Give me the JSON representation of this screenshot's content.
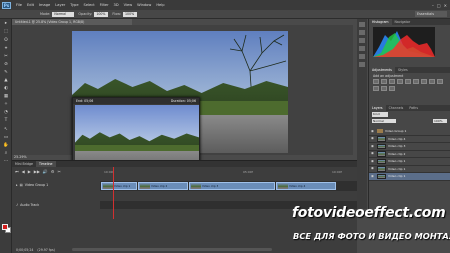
{
  "app": {
    "logo": "Ps"
  },
  "menu": [
    "File",
    "Edit",
    "Image",
    "Layer",
    "Type",
    "Select",
    "Filter",
    "3D",
    "View",
    "Window",
    "Help"
  ],
  "window_controls": [
    "–",
    "□",
    "✕"
  ],
  "options_bar": {
    "mode_label": "Mode:",
    "mode_value": "Normal",
    "opacity_label": "Opacity:",
    "opacity_value": "100%",
    "flow_label": "Flow:",
    "flow_value": "100%",
    "workspace": "Essentials"
  },
  "tools": [
    "▸",
    "⬚",
    "ʘ",
    "⌖",
    "✂",
    "⊘",
    "✎",
    "▲",
    "◐",
    "▦",
    "✧",
    "◔",
    "T",
    "↖",
    "▭",
    "✋",
    "⌕",
    "⋯"
  ],
  "document": {
    "tab_title": "Untitled-1 @ 25.8% (Video Group 1, RGB/8)",
    "zoom": "25.29%",
    "preview_start": "End: 05;06",
    "preview_duration": "Duration: 05;06"
  },
  "timeline": {
    "tabs": [
      "Mini Bridge",
      "Timeline"
    ],
    "controls": [
      "⏮",
      "◀",
      "▶",
      "▶▶",
      "🔊",
      "⚙",
      "✂"
    ],
    "ruler": [
      "10:00f",
      "05:00f",
      "10:00f"
    ],
    "video_track": "Video Group 1",
    "audio_track": "Audio Track",
    "clips": [
      {
        "label": "Video clip 1"
      },
      {
        "label": "Video clip 2"
      },
      {
        "label": "Video clip 3"
      },
      {
        "label": "Video clip 4"
      }
    ],
    "footer_time": "0;00;05;24",
    "footer_fps": "(29.97 fps)"
  },
  "right_panels": {
    "histogram_tabs": [
      "Histogram",
      "Navigator"
    ],
    "adjust_tabs": [
      "Adjustments",
      "Styles"
    ],
    "adjust_title": "Add an adjustment",
    "layers_tabs": [
      "Layers",
      "Channels",
      "Paths"
    ],
    "kind_label": "Kind",
    "blend": "Normal",
    "opacity": "100%",
    "layers": [
      {
        "name": "Video Group 1",
        "group": true,
        "selected": false
      },
      {
        "name": "Video clip 4",
        "group": false,
        "selected": false
      },
      {
        "name": "Video clip 3",
        "group": false,
        "selected": false
      },
      {
        "name": "Video clip 2",
        "group": false,
        "selected": false
      },
      {
        "name": "Video clip 1",
        "group": false,
        "selected": false
      },
      {
        "name": "Video clip 1",
        "group": false,
        "selected": false
      },
      {
        "name": "Video clip 1",
        "group": false,
        "selected": true
      }
    ]
  },
  "watermark": {
    "line1": "fotovideoeffect.com",
    "line2": "ВСЕ ДЛЯ ФОТО И ВИДЕО МОНТАЖА!"
  },
  "colors": {
    "foreground": "#d21c1c",
    "background": "#ffffff",
    "clip": "#6a8db8",
    "playhead": "#d23030"
  }
}
